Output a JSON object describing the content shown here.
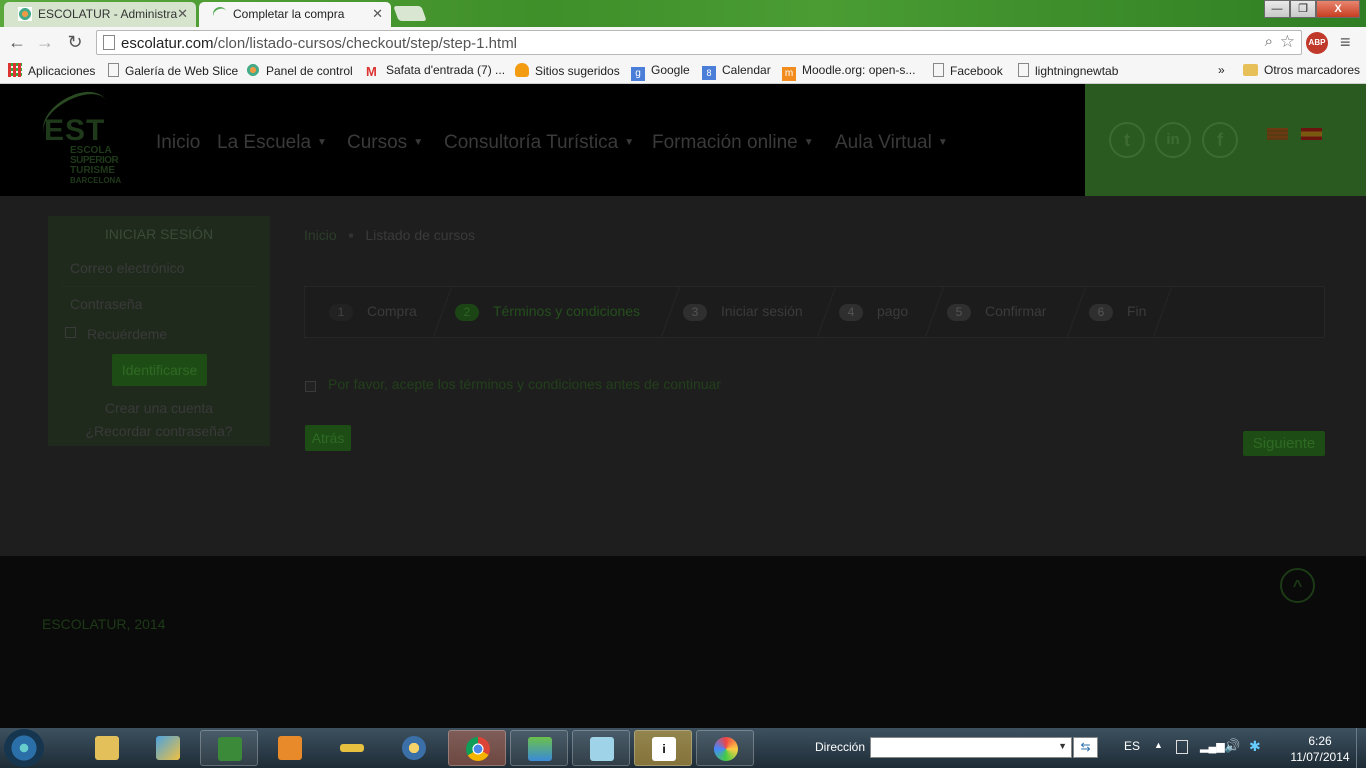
{
  "browser": {
    "tabs": [
      {
        "title": "ESCOLATUR - Administra",
        "active": false
      },
      {
        "title": "Completar la compra",
        "active": true
      }
    ],
    "url_host": "escolatur.com",
    "url_path": "/clon/listado-cursos/checkout/step/step-1.html",
    "window_buttons": {
      "minimize": "—",
      "maximize": "❐",
      "close": "X"
    },
    "bookmarks": [
      {
        "label": "Aplicaciones"
      },
      {
        "label": "Galería de Web Slice"
      },
      {
        "label": "Panel de control"
      },
      {
        "label": "Safata d'entrada (7) ..."
      },
      {
        "label": "Sitios sugeridos"
      },
      {
        "label": "Google"
      },
      {
        "label": "Calendar"
      },
      {
        "label": "Moodle.org: open-s..."
      },
      {
        "label": "Facebook"
      },
      {
        "label": "lightningnewtab"
      }
    ],
    "bookmarks_overflow": "»",
    "other_bookmarks": "Otros marcadores",
    "abp_label": "ABP"
  },
  "site": {
    "logo": {
      "mark": "EST",
      "lines": [
        "ESCOLA",
        "SUPERIOR",
        "TURISME",
        "BARCELONA"
      ]
    },
    "nav": [
      {
        "label": "Inicio",
        "dropdown": false
      },
      {
        "label": "La Escuela",
        "dropdown": true
      },
      {
        "label": "Cursos",
        "dropdown": true
      },
      {
        "label": "Consultoría Turística",
        "dropdown": true
      },
      {
        "label": "Formación online",
        "dropdown": true
      },
      {
        "label": "Aula Virtual",
        "dropdown": true
      }
    ],
    "social": {
      "twitter": "t",
      "linkedin": "in",
      "facebook": "f"
    },
    "login": {
      "title": "INICIAR SESIÓN",
      "email_placeholder": "Correo electrónico",
      "password_placeholder": "Contraseña",
      "remember": "Recuérdeme",
      "submit": "Identificarse",
      "create_account": "Crear una cuenta",
      "forgot": "¿Recordar contraseña?"
    },
    "breadcrumb": {
      "home": "Inicio",
      "separator": "■",
      "current": "Listado de cursos"
    },
    "steps": [
      {
        "num": "1",
        "label": "Compra"
      },
      {
        "num": "2",
        "label": "Términos y condiciones"
      },
      {
        "num": "3",
        "label": "Iniciar sesión"
      },
      {
        "num": "4",
        "label": "pago"
      },
      {
        "num": "5",
        "label": "Confirmar"
      },
      {
        "num": "6",
        "label": "Fin"
      }
    ],
    "terms_text": "Por favor, acepte los términos y condiciones antes de continuar",
    "back_button": "Atrás",
    "next_button": "Siguiente",
    "footer_text": "ESCOLATUR, 2014",
    "back_to_top": "^"
  },
  "taskbar": {
    "address_label": "Dirección",
    "lang": "ES",
    "time": "6:26",
    "date": "11/07/2014"
  },
  "colors": {
    "accent_green": "#2a5a1f",
    "overlay": "#1b1b1b"
  }
}
